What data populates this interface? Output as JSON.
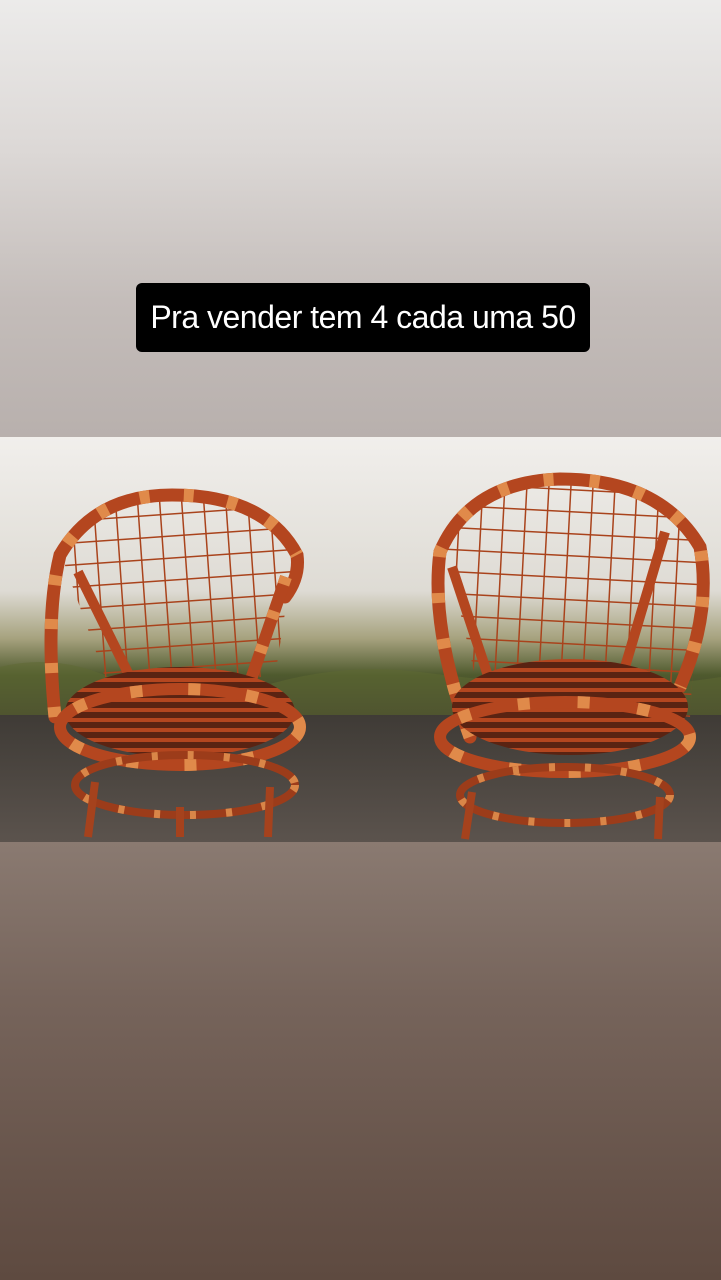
{
  "story": {
    "caption": "Pra vender tem 4 cada uma 50"
  },
  "photo": {
    "subject": "two wicker chairs",
    "colors": {
      "wall": "#e4e1dc",
      "moss": "#6f7a3c",
      "ground": "#4a4440",
      "wicker": "#b4461f",
      "wicker_dark": "#7f2d14",
      "wrap": "#e08a4a"
    }
  }
}
